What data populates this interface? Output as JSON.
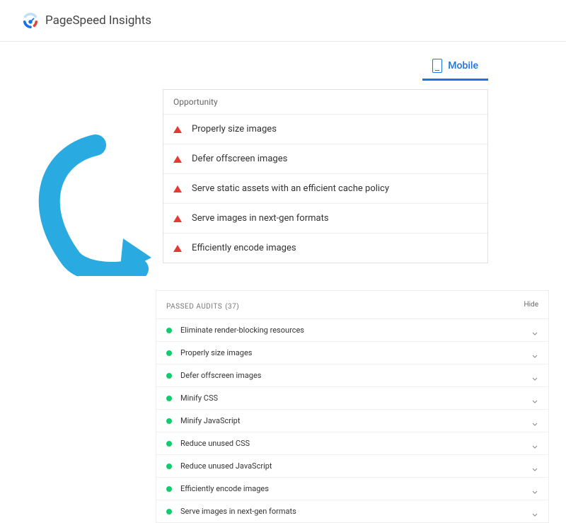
{
  "header": {
    "title": "PageSpeed Insights"
  },
  "tab": {
    "label": "Mobile"
  },
  "opportunity": {
    "heading": "Opportunity",
    "items": [
      {
        "label": "Properly size images"
      },
      {
        "label": "Defer offscreen images"
      },
      {
        "label": "Serve static assets with an efficient cache policy"
      },
      {
        "label": "Serve images in next-gen formats"
      },
      {
        "label": "Efficiently encode images"
      }
    ]
  },
  "passed": {
    "heading": "PASSED AUDITS",
    "count": "(37)",
    "hide_label": "Hide",
    "items": [
      {
        "label": "Eliminate render-blocking resources"
      },
      {
        "label": "Properly size images"
      },
      {
        "label": "Defer offscreen images"
      },
      {
        "label": "Minify CSS"
      },
      {
        "label": "Minify JavaScript"
      },
      {
        "label": "Reduce unused CSS"
      },
      {
        "label": "Reduce unused JavaScript"
      },
      {
        "label": "Efficiently encode images"
      },
      {
        "label": "Serve images in next-gen formats"
      }
    ]
  }
}
